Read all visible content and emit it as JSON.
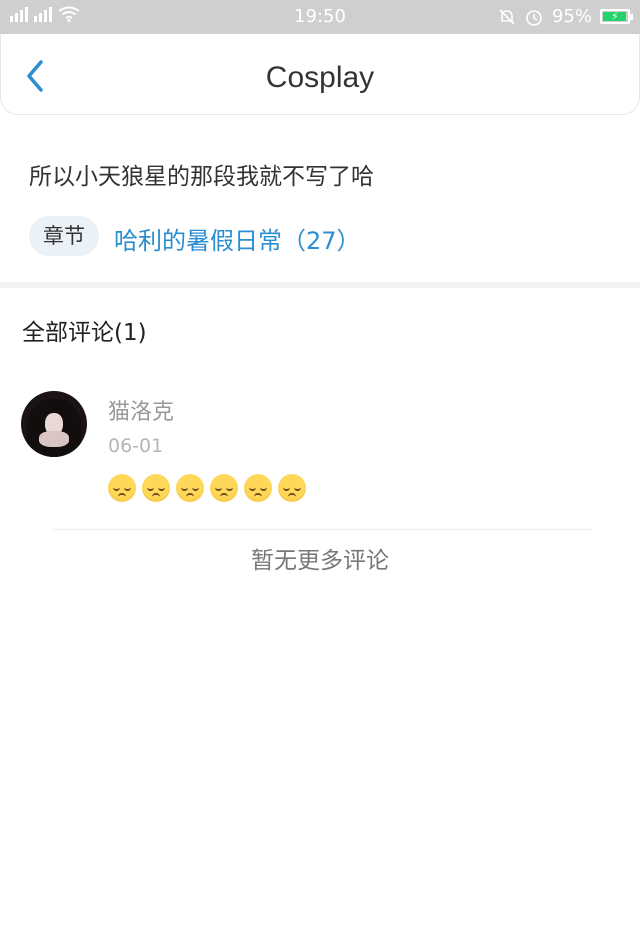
{
  "status_bar": {
    "time": "19:50",
    "battery_percent": "95%",
    "icons": [
      "signal-icon",
      "wifi-icon",
      "mute-icon",
      "alarm-icon",
      "battery-icon"
    ],
    "battery_level": 0.95
  },
  "nav": {
    "title": "Cosplay",
    "back_icon": "chevron-left-icon"
  },
  "post": {
    "text": "所以小天狼星的那段我就不写了哈",
    "chapter_tag": "章节",
    "chapter_link": "哈利的暑假日常（27）"
  },
  "comments": {
    "header": "全部评论(1)",
    "items": [
      {
        "user": "猫洛克",
        "date": "06-01",
        "body_emoji": "pensive-face-emoji",
        "emoji_count": 6
      }
    ],
    "no_more": "暂无更多评论"
  },
  "colors": {
    "accent": "#2a8ed0",
    "status_bar_bg": "#cfcfcf",
    "battery_green": "#22d46a"
  }
}
